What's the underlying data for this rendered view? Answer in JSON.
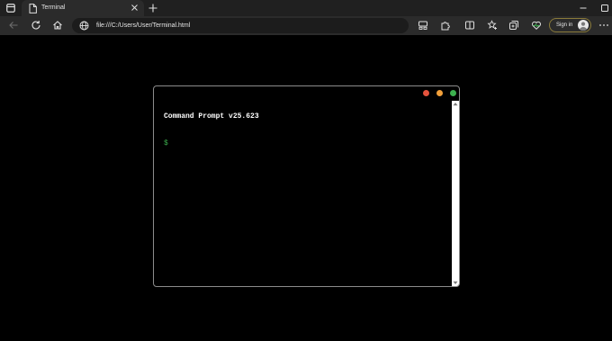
{
  "browser": {
    "tab": {
      "title": "Terminal"
    },
    "address_bar": {
      "url": "file:///C:/Users/User/Terminal.html"
    },
    "sign_in_label": "Sign in"
  },
  "terminal": {
    "title": "Command Prompt v25.623",
    "prompt_symbol": "$",
    "window_controls": {
      "close_color": "#e5533d",
      "minimize_color": "#f2a03a",
      "maximize_color": "#3db14f"
    }
  },
  "icons": {
    "tab_actions": "tab-actions-icon",
    "page": "page-icon",
    "tab_close": "close-icon",
    "new_tab": "plus-icon",
    "back": "back-arrow-icon",
    "refresh": "refresh-icon",
    "home": "home-icon",
    "site_info": "globe-icon",
    "read_aloud": "read-aloud-icon",
    "extensions": "puzzle-icon",
    "split_screen": "split-screen-icon",
    "favorites": "star-icon",
    "collections": "collections-icon",
    "browser_essentials": "heart-pulse-icon",
    "more": "more-icon"
  }
}
